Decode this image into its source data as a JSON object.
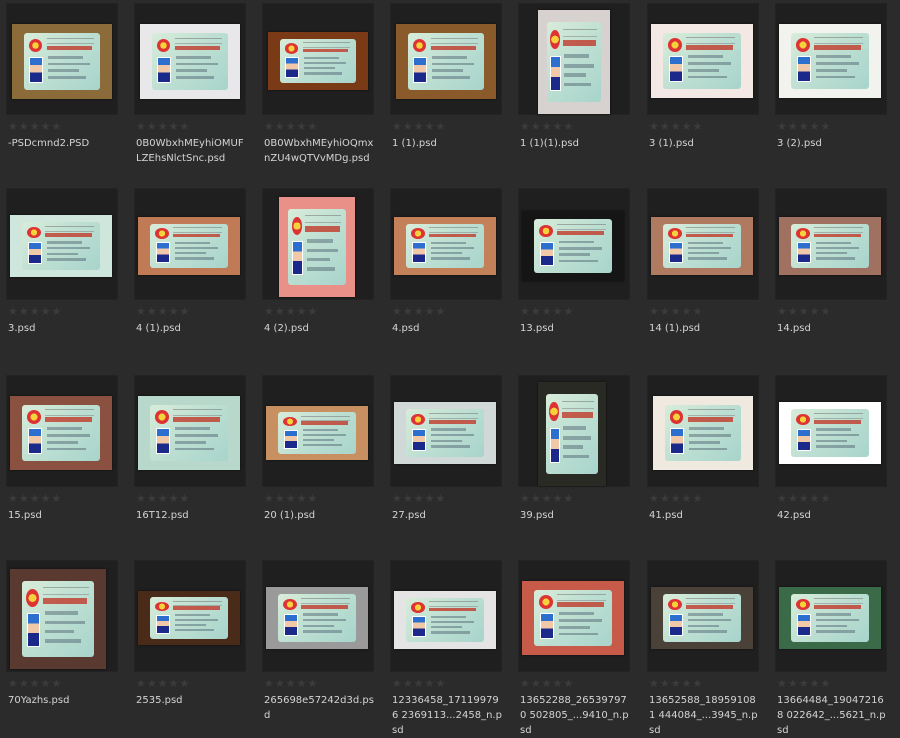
{
  "files": [
    {
      "name": "-PSDcmnd2.PSD",
      "rating": "★★★★★",
      "bg": "#8b6b3a"
    },
    {
      "name": "0B0WbxhMEyhiOMUFLZEhsNlctSnc.psd",
      "rating": "★★★★★",
      "bg": "#e8e8ea"
    },
    {
      "name": "0B0WbxhMEyhiOQmxnZU4wQTVvMDg.psd",
      "rating": "★★★★★",
      "bg": "#7a3a16"
    },
    {
      "name": "1 (1).psd",
      "rating": "★★★★★",
      "bg": "#8a5a2a"
    },
    {
      "name": "1 (1)(1).psd",
      "rating": "★★★★★",
      "bg": "#d7d2cf"
    },
    {
      "name": "3 (1).psd",
      "rating": "★★★★★",
      "bg": "#f3e8e4"
    },
    {
      "name": "3 (2).psd",
      "rating": "★★★★★",
      "bg": "#f2f2ee"
    },
    {
      "name": "3.psd",
      "rating": "★★★★★",
      "bg": "#cfe6dc"
    },
    {
      "name": "4 (1).psd",
      "rating": "★★★★★",
      "bg": "#c07a55"
    },
    {
      "name": "4 (2).psd",
      "rating": "★★★★★",
      "bg": "#e99088"
    },
    {
      "name": "4.psd",
      "rating": "★★★★★",
      "bg": "#c48058"
    },
    {
      "name": "13.psd",
      "rating": "★★★★★",
      "bg": "#151515"
    },
    {
      "name": "14 (1).psd",
      "rating": "★★★★★",
      "bg": "#b07a60"
    },
    {
      "name": "14.psd",
      "rating": "★★★★★",
      "bg": "#a07060"
    },
    {
      "name": "15.psd",
      "rating": "★★★★★",
      "bg": "#8a5040"
    },
    {
      "name": "16T12.psd",
      "rating": "★★★★★",
      "bg": "#b8d8cc"
    },
    {
      "name": "20 (1).psd",
      "rating": "★★★★★",
      "bg": "#c89060"
    },
    {
      "name": "27.psd",
      "rating": "★★★★★",
      "bg": "#d0d8d8"
    },
    {
      "name": "39.psd",
      "rating": "★★★★★",
      "bg": "#2a2a25"
    },
    {
      "name": "41.psd",
      "rating": "★★★★★",
      "bg": "#efe9df"
    },
    {
      "name": "42.psd",
      "rating": "★★★★★",
      "bg": "#ffffff"
    },
    {
      "name": "70Yazhs.psd",
      "rating": "★★★★★",
      "bg": "#5a3a30"
    },
    {
      "name": "2535.psd",
      "rating": "★★★★★",
      "bg": "#4a2a18"
    },
    {
      "name": "265698e57242d3d.psd",
      "rating": "★★★★★",
      "bg": "#9a9a9a"
    },
    {
      "name": "12336458_171199796 2369113...2458_n.psd",
      "rating": "★★★★★",
      "bg": "#e4e4e4"
    },
    {
      "name": "13652288_265397970 502805_...9410_n.psd",
      "rating": "★★★★★",
      "bg": "#c85a4a"
    },
    {
      "name": "13652588_189591081 444084_...3945_n.psd",
      "rating": "★★★★★",
      "bg": "#4a4238"
    },
    {
      "name": "13664484_190472168 022642_...5621_n.psd",
      "rating": "★★★★★",
      "bg": "#3a6a48"
    }
  ]
}
